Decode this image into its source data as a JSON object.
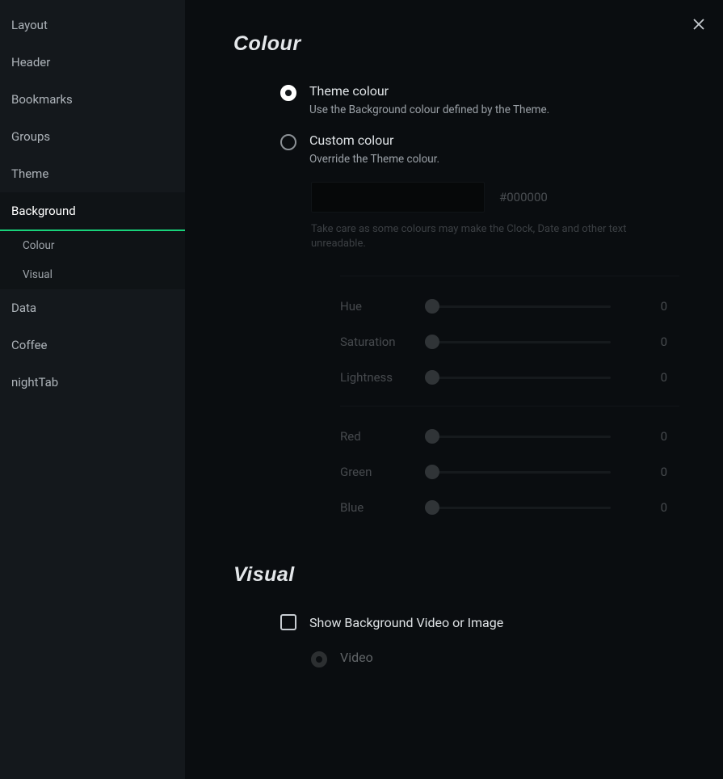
{
  "sidebar": {
    "items": [
      {
        "label": "Layout"
      },
      {
        "label": "Header"
      },
      {
        "label": "Bookmarks"
      },
      {
        "label": "Groups"
      },
      {
        "label": "Theme"
      },
      {
        "label": "Background",
        "active": true
      },
      {
        "label": "Data"
      },
      {
        "label": "Coffee"
      },
      {
        "label": "nightTab"
      }
    ],
    "sub": [
      {
        "label": "Colour"
      },
      {
        "label": "Visual"
      }
    ]
  },
  "sections": {
    "colour": {
      "title": "Colour",
      "theme": {
        "label": "Theme colour",
        "desc": "Use the Background colour defined by the Theme."
      },
      "custom": {
        "label": "Custom colour",
        "desc": "Override the Theme colour.",
        "hex": "#000000",
        "warn": "Take care as some colours may make the Clock, Date and other text unreadable."
      },
      "sliders": {
        "hue": {
          "label": "Hue",
          "value": "0"
        },
        "saturation": {
          "label": "Saturation",
          "value": "0"
        },
        "lightness": {
          "label": "Lightness",
          "value": "0"
        },
        "red": {
          "label": "Red",
          "value": "0"
        },
        "green": {
          "label": "Green",
          "value": "0"
        },
        "blue": {
          "label": "Blue",
          "value": "0"
        }
      }
    },
    "visual": {
      "title": "Visual",
      "show": "Show Background Video or Image",
      "video": "Video"
    }
  }
}
